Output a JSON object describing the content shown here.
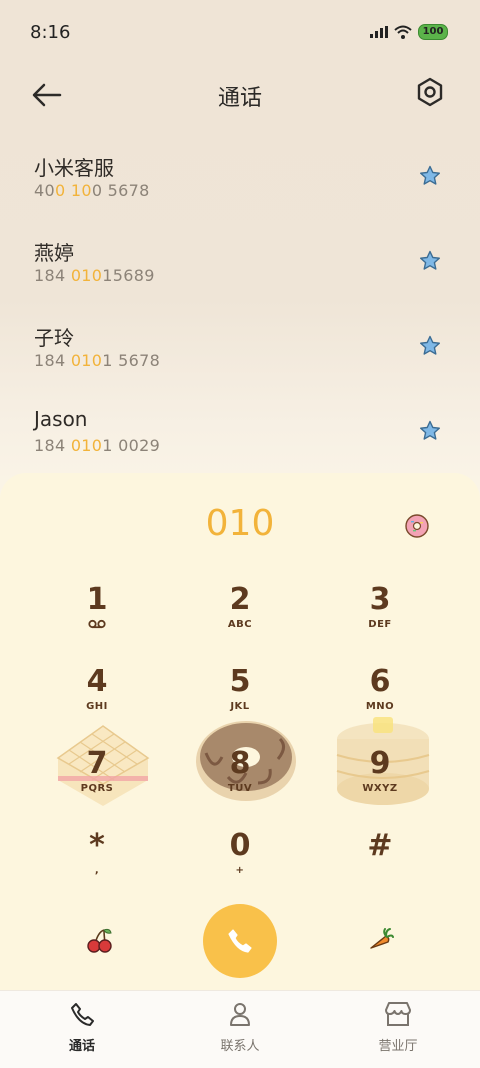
{
  "status": {
    "time": "8:16",
    "battery": "100"
  },
  "header": {
    "title": "通话",
    "back_icon": "arrow-left-icon",
    "settings_icon": "settings-hexagon-icon"
  },
  "contacts": [
    {
      "name": "小米客服",
      "num_pre": "40",
      "num_hl1": "0",
      "num_mid": " ",
      "num_hl2": "10",
      "num_post": "0 5678"
    },
    {
      "name": "燕婷",
      "num_pre": "184 ",
      "num_hl1": "010",
      "num_mid": "",
      "num_hl2": "",
      "num_post": "15689"
    },
    {
      "name": "子玲",
      "num_pre": "184 ",
      "num_hl1": "010",
      "num_mid": "",
      "num_hl2": "",
      "num_post": "1 5678"
    },
    {
      "name": "Jason",
      "num_pre": "184 ",
      "num_hl1": "010",
      "num_mid": "",
      "num_hl2": "",
      "num_post": "1 0029"
    }
  ],
  "dial": {
    "input": "010"
  },
  "keys": [
    {
      "digit": "1",
      "letters": ""
    },
    {
      "digit": "2",
      "letters": "ABC"
    },
    {
      "digit": "3",
      "letters": "DEF"
    },
    {
      "digit": "4",
      "letters": "GHI"
    },
    {
      "digit": "5",
      "letters": "JKL"
    },
    {
      "digit": "6",
      "letters": "MNO"
    },
    {
      "digit": "7",
      "letters": "PQRS"
    },
    {
      "digit": "8",
      "letters": "TUV"
    },
    {
      "digit": "9",
      "letters": "WXYZ"
    },
    {
      "digit": "*",
      "letters": ","
    },
    {
      "digit": "0",
      "letters": "+"
    },
    {
      "digit": "#",
      "letters": ""
    }
  ],
  "nav": [
    {
      "label": "通话",
      "icon": "phone-icon",
      "active": true
    },
    {
      "label": "联系人",
      "icon": "person-icon",
      "active": false
    },
    {
      "label": "营业厅",
      "icon": "store-icon",
      "active": false
    }
  ],
  "colors": {
    "accent": "#f2b33a",
    "key_text": "#5d3a1f",
    "call_button": "#f9c14a"
  }
}
